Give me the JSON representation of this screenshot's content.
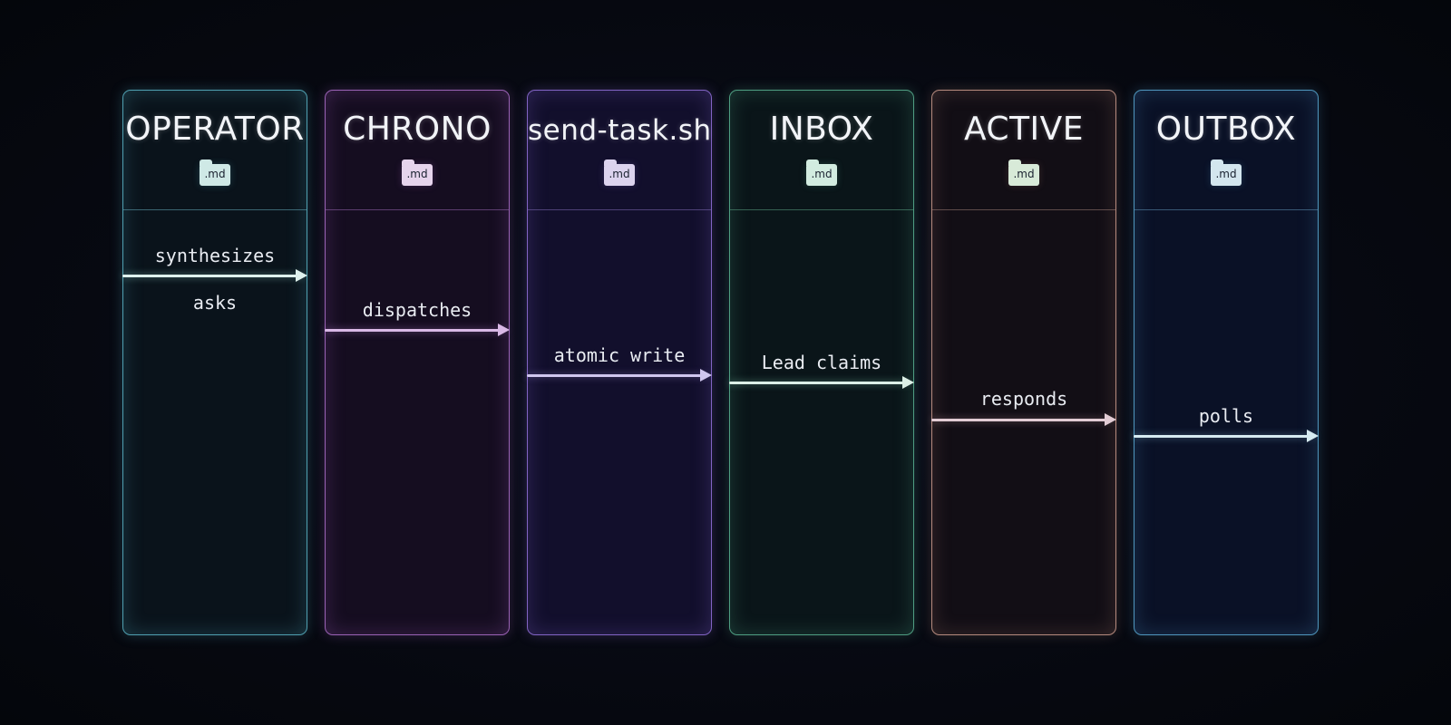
{
  "lanes": [
    {
      "title": "OPERATOR",
      "file": ".md",
      "color": "#5fb3c4"
    },
    {
      "title": "CHRONO",
      "file": ".md",
      "color": "#a66bc2"
    },
    {
      "title": "send-task.sh",
      "file": ".md",
      "color": "#8e6fd0"
    },
    {
      "title": "INBOX",
      "file": ".md",
      "color": "#5fb494"
    },
    {
      "title": "ACTIVE",
      "file": ".md",
      "color": "#c89a8c"
    },
    {
      "title": "OUTBOX",
      "file": ".md",
      "color": "#5aa6d0"
    }
  ],
  "flows": [
    {
      "label": "synthesizes",
      "from": "OPERATOR",
      "to": "CHRONO"
    },
    {
      "label": "asks",
      "from": "OPERATOR",
      "to": "CHRONO"
    },
    {
      "label": "dispatches",
      "from": "CHRONO",
      "to": "send-task.sh"
    },
    {
      "label": "atomic write",
      "from": "send-task.sh",
      "to": "INBOX"
    },
    {
      "label": "Lead claims",
      "from": "INBOX",
      "to": "ACTIVE"
    },
    {
      "label": "responds",
      "from": "ACTIVE",
      "to": "OUTBOX"
    },
    {
      "label": "polls",
      "from": "OUTBOX",
      "to": ""
    }
  ]
}
